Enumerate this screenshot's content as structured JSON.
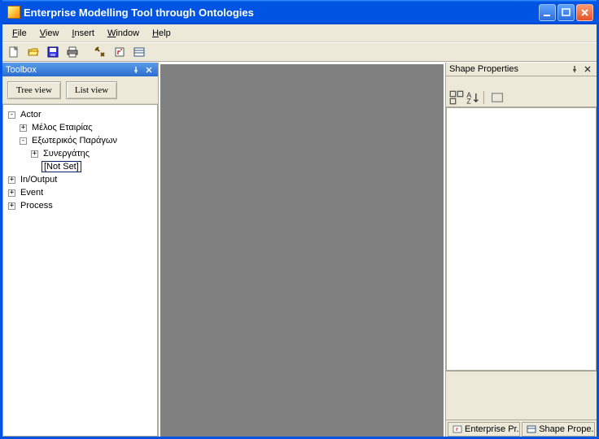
{
  "title": "Enterprise Modelling Tool through Ontologies",
  "menubar": [
    "File",
    "View",
    "Insert",
    "Window",
    "Help"
  ],
  "menubar_accel": [
    "F",
    "V",
    "I",
    "W",
    "H"
  ],
  "toolbox": {
    "title": "Toolbox",
    "btn_tree": "Tree view",
    "btn_list": "List view",
    "tree": {
      "n0": {
        "label": "Actor",
        "exp": "-"
      },
      "n0_0": {
        "label": "Μέλος Εταιρίας",
        "exp": "+"
      },
      "n0_1": {
        "label": "Εξωτερικός Παράγων",
        "exp": "-"
      },
      "n0_1_0": {
        "label": "Συνεργάτης",
        "exp": "+"
      },
      "n0_1_1": {
        "label": "[Not Set]",
        "exp": ""
      },
      "n1": {
        "label": "In/Output",
        "exp": "+"
      },
      "n2": {
        "label": "Event",
        "exp": "+"
      },
      "n3": {
        "label": "Process",
        "exp": "+"
      }
    }
  },
  "props": {
    "title": "Shape Properties",
    "tab1": "Enterprise Pr...",
    "tab2": "Shape Prope..."
  }
}
